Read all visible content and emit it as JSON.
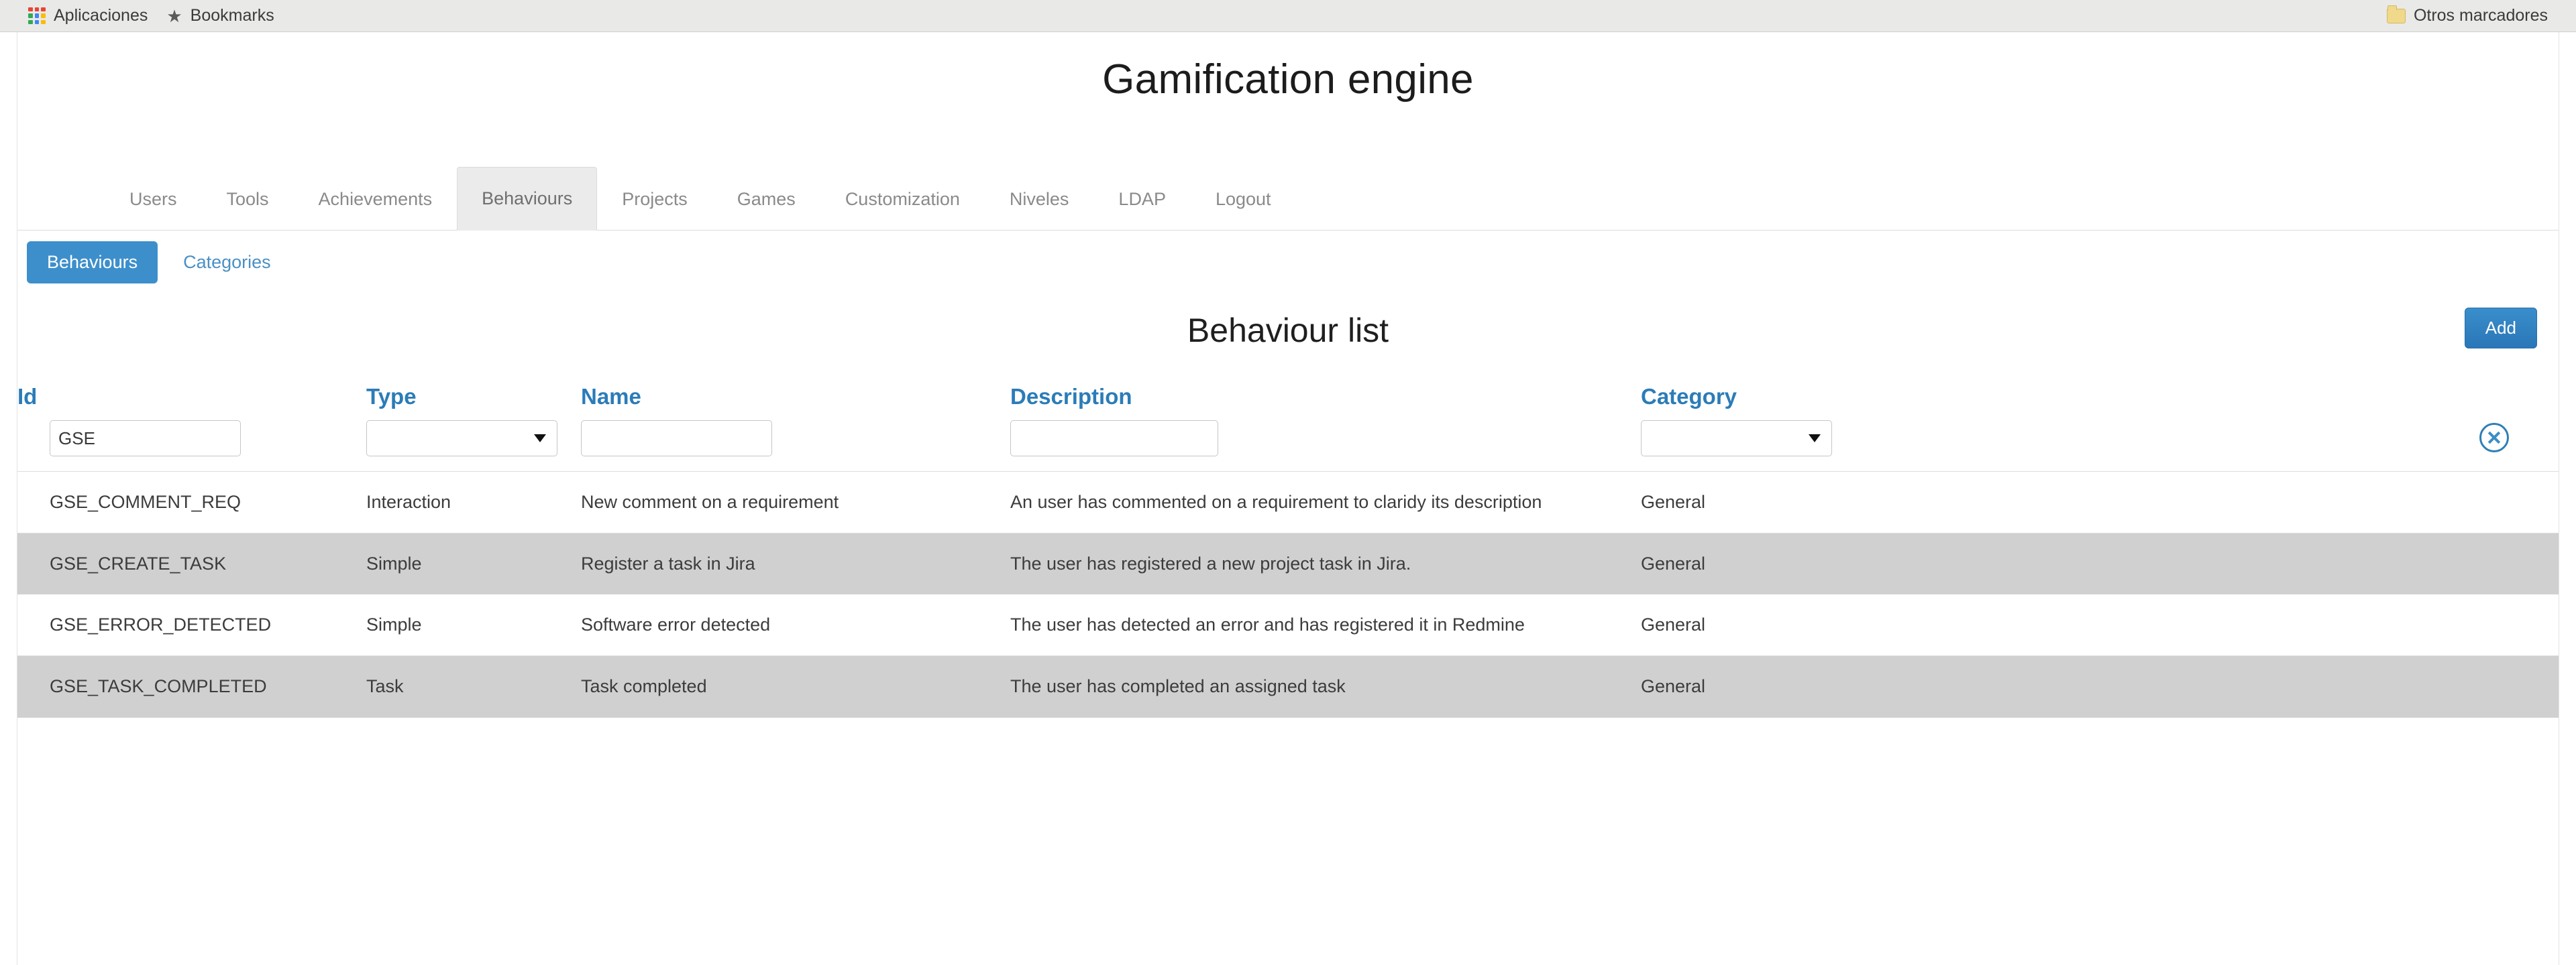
{
  "browser": {
    "bookmarks": [
      {
        "icon": "apps-grid-icon",
        "label": "Aplicaciones"
      },
      {
        "icon": "star-icon",
        "label": "Bookmarks"
      }
    ],
    "other_bookmarks": {
      "icon": "folder-icon",
      "label": "Otros marcadores"
    }
  },
  "app": {
    "title": "Gamification engine"
  },
  "nav": {
    "tabs": [
      {
        "label": "Users",
        "active": false
      },
      {
        "label": "Tools",
        "active": false
      },
      {
        "label": "Achievements",
        "active": false
      },
      {
        "label": "Behaviours",
        "active": true
      },
      {
        "label": "Projects",
        "active": false
      },
      {
        "label": "Games",
        "active": false
      },
      {
        "label": "Customization",
        "active": false
      },
      {
        "label": "Niveles",
        "active": false
      },
      {
        "label": "LDAP",
        "active": false
      },
      {
        "label": "Logout",
        "active": false
      }
    ]
  },
  "subnav": {
    "tabs": [
      {
        "label": "Behaviours",
        "active": true
      },
      {
        "label": "Categories",
        "active": false
      }
    ]
  },
  "content": {
    "title": "Behaviour list",
    "add_label": "Add",
    "clear_icon": "clear-filters-icon"
  },
  "table": {
    "headers": [
      "Id",
      "Type",
      "Name",
      "Description",
      "Category"
    ],
    "filters": {
      "id": {
        "value": "GSE",
        "placeholder": ""
      },
      "type": {
        "value": "",
        "options": [
          ""
        ]
      },
      "name": {
        "value": "",
        "placeholder": ""
      },
      "description": {
        "value": "",
        "placeholder": ""
      },
      "category": {
        "value": "",
        "options": [
          ""
        ]
      }
    },
    "rows": [
      {
        "id": "GSE_COMMENT_REQ",
        "type": "Interaction",
        "name": "New comment on a requirement",
        "description": "An user has commented on a requirement to claridy its description",
        "category": "General",
        "striped": false
      },
      {
        "id": "GSE_CREATE_TASK",
        "type": "Simple",
        "name": "Register a task in Jira",
        "description": "The user has registered a new project task in Jira.",
        "category": "General",
        "striped": true
      },
      {
        "id": "GSE_ERROR_DETECTED",
        "type": "Simple",
        "name": "Software error detected",
        "description": "The user has detected an error and has registered it in Redmine",
        "category": "General",
        "striped": false
      },
      {
        "id": "GSE_TASK_COMPLETED",
        "type": "Task",
        "name": "Task completed",
        "description": "The user has completed an assigned task",
        "category": "General",
        "striped": true
      }
    ]
  },
  "colors": {
    "accent_blue": "#2b7cb8",
    "pill_active": "#3d8fcc",
    "button_blue": "#2f7fc1",
    "stripe_gray": "#d0d0d0",
    "bookmark_bar": "#e9e9e7"
  }
}
